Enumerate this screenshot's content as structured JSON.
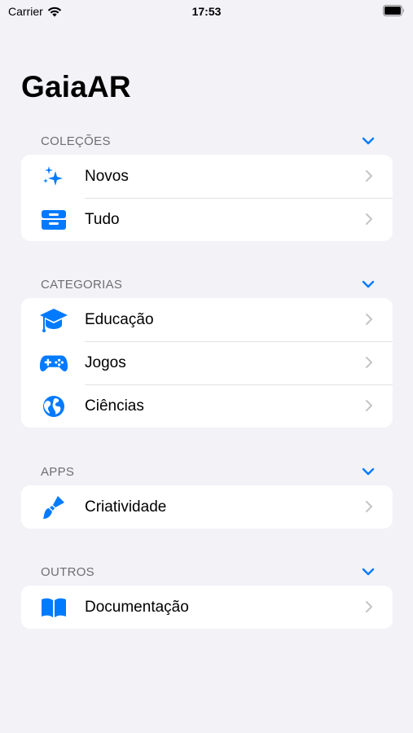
{
  "status_bar": {
    "carrier": "Carrier",
    "time": "17:53"
  },
  "app_title": "GaiaAR",
  "accent_color": "#007aff",
  "sections": [
    {
      "label": "COLEÇÕES",
      "items": [
        {
          "label": "Novos",
          "icon": "sparkles-icon"
        },
        {
          "label": "Tudo",
          "icon": "tray-icon"
        }
      ]
    },
    {
      "label": "CATEGORIAS",
      "items": [
        {
          "label": "Educação",
          "icon": "graduation-cap-icon"
        },
        {
          "label": "Jogos",
          "icon": "gamecontroller-icon"
        },
        {
          "label": "Ciências",
          "icon": "globe-icon"
        }
      ]
    },
    {
      "label": "APPS",
      "items": [
        {
          "label": "Criatividade",
          "icon": "paintbrush-icon"
        }
      ]
    },
    {
      "label": "OUTROS",
      "items": [
        {
          "label": "Documentação",
          "icon": "book-icon"
        }
      ]
    }
  ]
}
